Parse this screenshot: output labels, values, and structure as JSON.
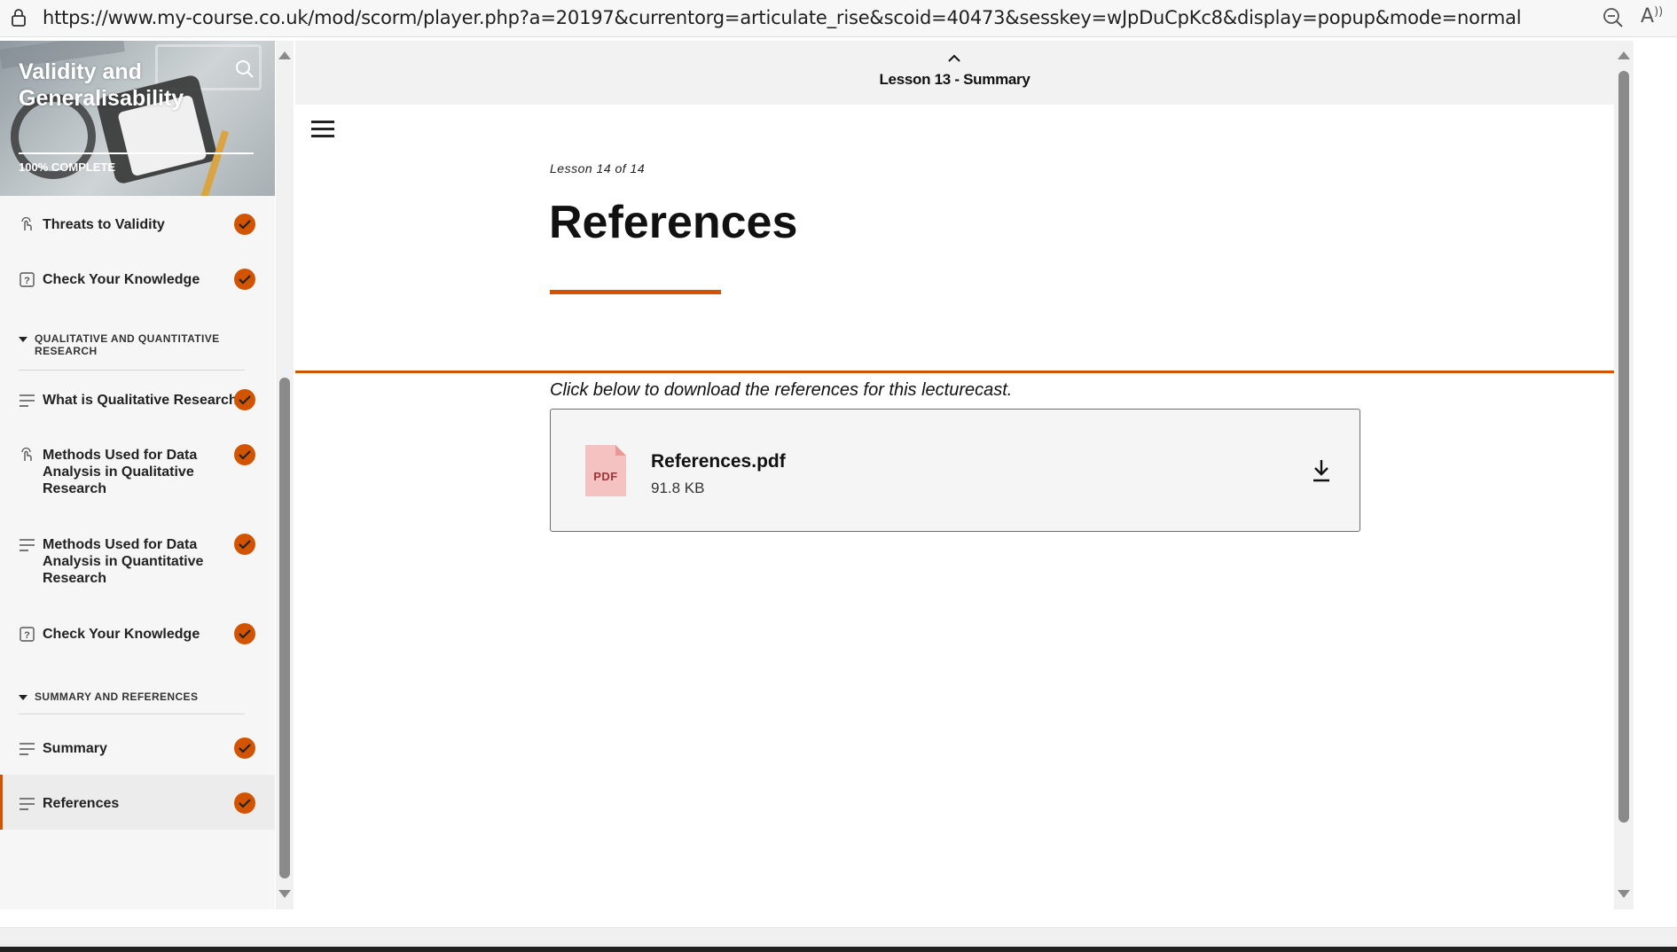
{
  "browser": {
    "url": "https://www.my-course.co.uk/mod/scorm/player.php?a=20197&currentorg=articulate_rise&scoid=40473&sesskey=wJpDuCpKc8&display=popup&mode=normal",
    "read_aloud_label": "A̷"
  },
  "sidebar": {
    "course_title": "Validity and Generalisability",
    "progress_label": "100% COMPLETE",
    "progress_fraction": 1.0,
    "items": [
      {
        "type": "lesson",
        "icon": "interaction-icon",
        "label": "Threats to Validity",
        "completed": true
      },
      {
        "type": "lesson",
        "icon": "quiz-icon",
        "label": "Check Your Knowledge",
        "completed": true
      },
      {
        "type": "section",
        "label": "QUALITATIVE AND QUANTITATIVE RESEARCH"
      },
      {
        "type": "lesson",
        "icon": "text-lines-icon",
        "label": "What is Qualitative Research?",
        "completed": true
      },
      {
        "type": "lesson",
        "icon": "interaction-icon",
        "label": "Methods Used for Data Analysis in Qualitative Research",
        "completed": true
      },
      {
        "type": "lesson",
        "icon": "text-lines-icon",
        "label": "Methods Used for Data Analysis in Quantitative Research",
        "completed": true
      },
      {
        "type": "lesson",
        "icon": "quiz-icon",
        "label": "Check Your Knowledge",
        "completed": true
      },
      {
        "type": "section",
        "label": "SUMMARY AND REFERENCES"
      },
      {
        "type": "lesson",
        "icon": "text-lines-icon",
        "label": "Summary",
        "completed": true
      },
      {
        "type": "lesson",
        "icon": "text-lines-icon",
        "label": "References",
        "completed": true,
        "active": true
      }
    ]
  },
  "main": {
    "previous_lesson_label": "Lesson 13 - Summary",
    "lesson_count": "Lesson 14 of 14",
    "title": "References",
    "intro_text": "Click below to download the references for this lecturecast.",
    "file": {
      "name": "References.pdf",
      "size": "91.8 KB",
      "type_badge": "PDF"
    }
  },
  "colors": {
    "accent": "#d35400",
    "sidebar_bg": "#f6f6f6",
    "prev_bar_bg": "#f2f2f2"
  }
}
